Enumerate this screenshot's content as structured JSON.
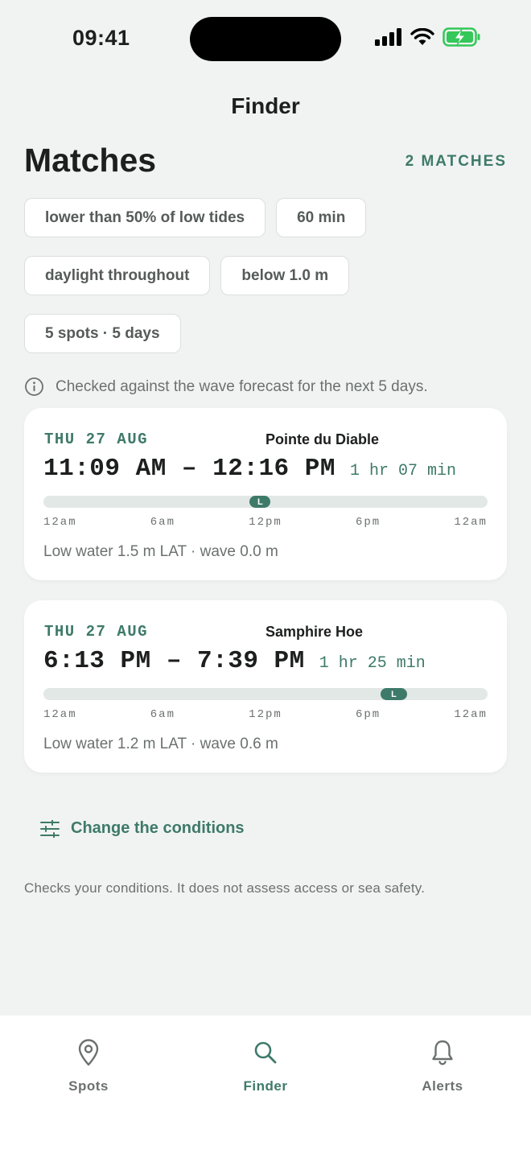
{
  "status": {
    "time": "09:41"
  },
  "nav": {
    "title": "Finder"
  },
  "header": {
    "title": "Matches",
    "count": "2 MATCHES"
  },
  "chips": {
    "row1": [
      "lower than 50% of low tides",
      "60 min"
    ],
    "row2": [
      "daylight throughout",
      "below 1.0 m"
    ],
    "row3": [
      "5 spots · 5 days"
    ]
  },
  "info": {
    "text": "Checked against the wave forecast for the next 5 days."
  },
  "timeline_ticks": [
    "12am",
    "6am",
    "12pm",
    "6pm",
    "12am"
  ],
  "matches": [
    {
      "date": "THU 27 AUG",
      "spot": "Pointe du Diable",
      "range": "11:09 AM – 12:16 PM",
      "duration": "1 hr 07 min",
      "marker_label": "L",
      "window_start_hour": 11.15,
      "window_end_hour": 12.27,
      "summary": "Low water 1.5 m LAT · wave 0.0 m"
    },
    {
      "date": "THU 27 AUG",
      "spot": "Samphire Hoe",
      "range": "6:13 PM – 7:39 PM",
      "duration": "1 hr 25 min",
      "marker_label": "L",
      "window_start_hour": 18.22,
      "window_end_hour": 19.65,
      "summary": "Low water 1.2 m LAT · wave 0.6 m"
    }
  ],
  "actions": {
    "change_conditions": "Change the conditions"
  },
  "disclaimer": "Checks your conditions. It does not assess access or sea safety.",
  "tabs": [
    {
      "label": "Spots",
      "icon": "map-pin-icon"
    },
    {
      "label": "Finder",
      "icon": "search-icon"
    },
    {
      "label": "Alerts",
      "icon": "bell-icon"
    }
  ],
  "colors": {
    "accent": "#3e7a69",
    "battery": "#34c759",
    "background": "#f1f3f2"
  }
}
